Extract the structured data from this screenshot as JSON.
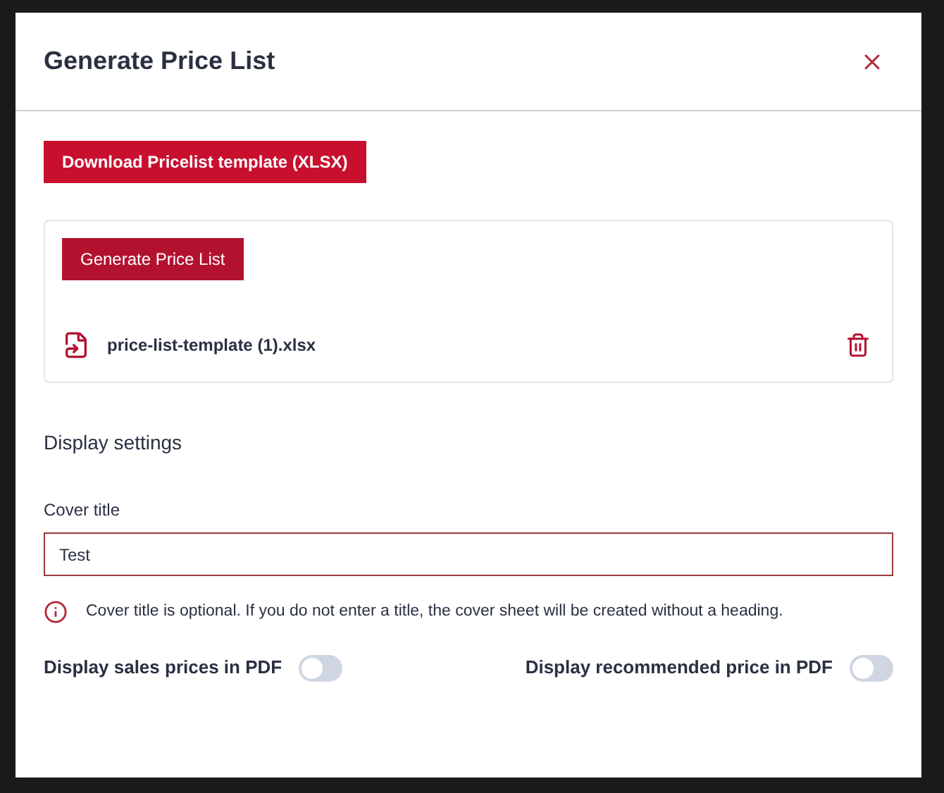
{
  "dialog": {
    "title": "Generate Price List"
  },
  "download_button": {
    "label": "Download Pricelist template (XLSX)"
  },
  "upload_panel": {
    "generate_button": {
      "label": "Generate Price List"
    },
    "file": {
      "name": "price-list-template (1).xlsx"
    }
  },
  "section_title": "Display settings",
  "cover_title": {
    "label": "Cover title",
    "value": "Test"
  },
  "info_text": "Cover title is optional. If you do not enter a title, the cover sheet will be created without a heading.",
  "toggles": [
    {
      "label": "Display sales prices in PDF",
      "on": false
    },
    {
      "label": "Display recommended price in PDF",
      "on": false
    }
  ]
}
